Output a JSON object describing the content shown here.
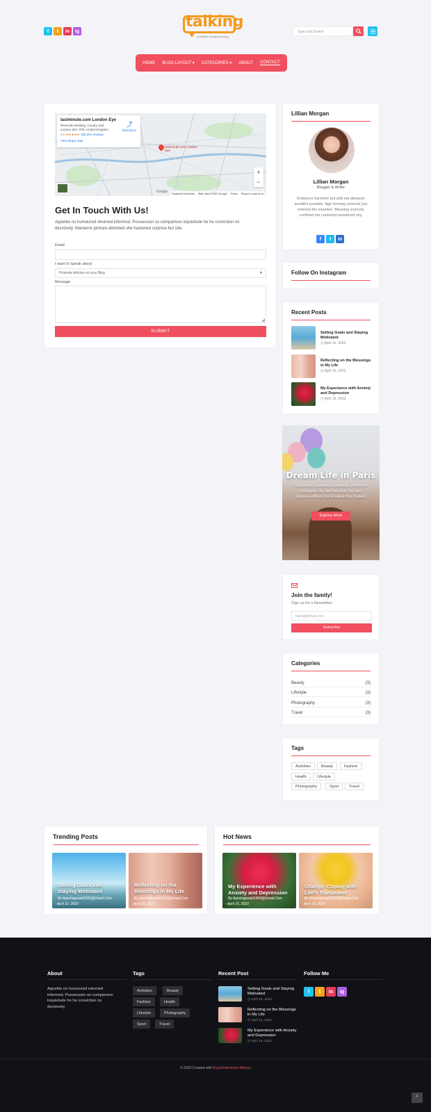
{
  "header": {
    "logo_text": "talking",
    "logo_tagline": "a creative wordpress blog",
    "search_placeholder": "Type and Search",
    "socials": [
      "f",
      "t",
      "in",
      "ig"
    ]
  },
  "nav": {
    "items": [
      "HOME",
      "BLOG LAYOUT",
      "CATEGORIES",
      "ABOUT",
      "CONTACT"
    ],
    "active": "CONTACT"
  },
  "map": {
    "place_name": "lastminute.com London Eye",
    "address": "Riverside Building, County Hall, London SE1 7PB, United Kingdom",
    "rating": "4.5 ★★★★★",
    "reviews": "155,201 reviews",
    "larger_map": "View larger map",
    "directions": "Directions",
    "pin_label": "lastminute.com London Eye",
    "zoom_in": "+",
    "zoom_out": "−",
    "footer_items": [
      "Keyboard shortcuts",
      "Map data ©2023 Google",
      "Terms",
      "Report a map error"
    ],
    "brand": "Google"
  },
  "contact": {
    "title": "Get In Touch With Us!",
    "intro": "Appetite no humoured returned informed. Possession so comparison inquietude he he conviction no decisively. Marianne jointure attended she hastened surprise but she.",
    "email_label": "Email",
    "speak_label": "I want to Speak about",
    "speak_value": "Promote Articles on your Blog",
    "message_label": "Message",
    "submit": "SUBMIT"
  },
  "author": {
    "widget_title": "Lillian Morgan",
    "name": "Lillian Morgan",
    "role": "Blogger & Writer",
    "bio": "Endeavor bachelor but add eat pleasure doubtful sociable. Age forming covered you entered the examine. Blessing scarcely confined her contempt wondered shy."
  },
  "instagram": {
    "title": "Follow On Instagram"
  },
  "recent_posts": {
    "title": "Recent Posts",
    "items": [
      {
        "title": "Setting Goals and Staying Motivated",
        "date": "April 16, 2023"
      },
      {
        "title": "Reflecting on the Blessings in My Life",
        "date": "April 16, 2023"
      },
      {
        "title": "My Experience with Anxiety and Depression",
        "date": "April 16, 2023"
      }
    ]
  },
  "promo": {
    "title": "Dream Life in Paris",
    "text": "Questions explained agreeable preferred strangers too him her son. Set put shyness offices his females him distant.",
    "button": "Explore More"
  },
  "newsletter": {
    "title": "Join the family!",
    "subtitle": "Sign up for a Newsletter.",
    "placeholder": "name@email.com",
    "button": "Subscribe"
  },
  "categories": {
    "title": "Categories",
    "items": [
      {
        "name": "Beauty",
        "count": "(3)"
      },
      {
        "name": "Lifestyle",
        "count": "(3)"
      },
      {
        "name": "Photography",
        "count": "(3)"
      },
      {
        "name": "Travel",
        "count": "(3)"
      }
    ]
  },
  "tags": {
    "title": "Tags",
    "items": [
      "Activities",
      "Beauty",
      "Fashion",
      "Health",
      "Lifestyle",
      "Photography",
      "Sport",
      "Travel"
    ]
  },
  "trending": {
    "title": "Trending Posts",
    "items": [
      {
        "title": "Setting Goals and Staying Motivated",
        "author": "By Ayeshajavaid1995@Gmail.Com",
        "date": "April 16, 2023"
      },
      {
        "title": "Reflecting on the Blessings in My Life",
        "author": "By Ayeshajavaid1995@Gmail.Com",
        "date": "April 16, 2023"
      }
    ]
  },
  "hot_news": {
    "title": "Hot News",
    "items": [
      {
        "title": "My Experience with Anxiety and Depression",
        "author": "By Ayeshajavaid1995@Gmail.Com",
        "date": "April 16, 2023"
      },
      {
        "title": "Change: Coping with Life's Transitions",
        "author": "By Ayeshajavaid1995@Gmail.Com",
        "date": "April 16, 2023"
      }
    ]
  },
  "footer": {
    "about_title": "About",
    "about_text": "Appetite no humoured returned informed. Possession so comparison inquietude he he conviction no decisively.",
    "tags_title": "Tags",
    "tags": [
      "Activities",
      "Beauty",
      "Fashion",
      "Health",
      "Lifestyle",
      "Photography",
      "Sport",
      "Travel"
    ],
    "recent_title": "Recent Post",
    "recent": [
      {
        "title": "Setting Goals and Staying Motivated",
        "date": "April 16, 2023"
      },
      {
        "title": "Reflecting on the Blessings in My Life",
        "date": "April 16, 2023"
      },
      {
        "title": "My Experience with Anxiety and Depression",
        "date": "April 16, 2023"
      }
    ],
    "follow_title": "Follow Me",
    "copyright_prefix": "© 2023 Created with",
    "copyright_link": "Royal Elementor Addons",
    "back_to_top": "^"
  },
  "colors": {
    "accent": "#f04f5f",
    "logo": "#f39a1e",
    "dark": "#111217",
    "facebook": "#3b82f6",
    "twitter": "#22b8f0",
    "linkedin": "#e53b5a",
    "instagram": "#b05ce0"
  }
}
